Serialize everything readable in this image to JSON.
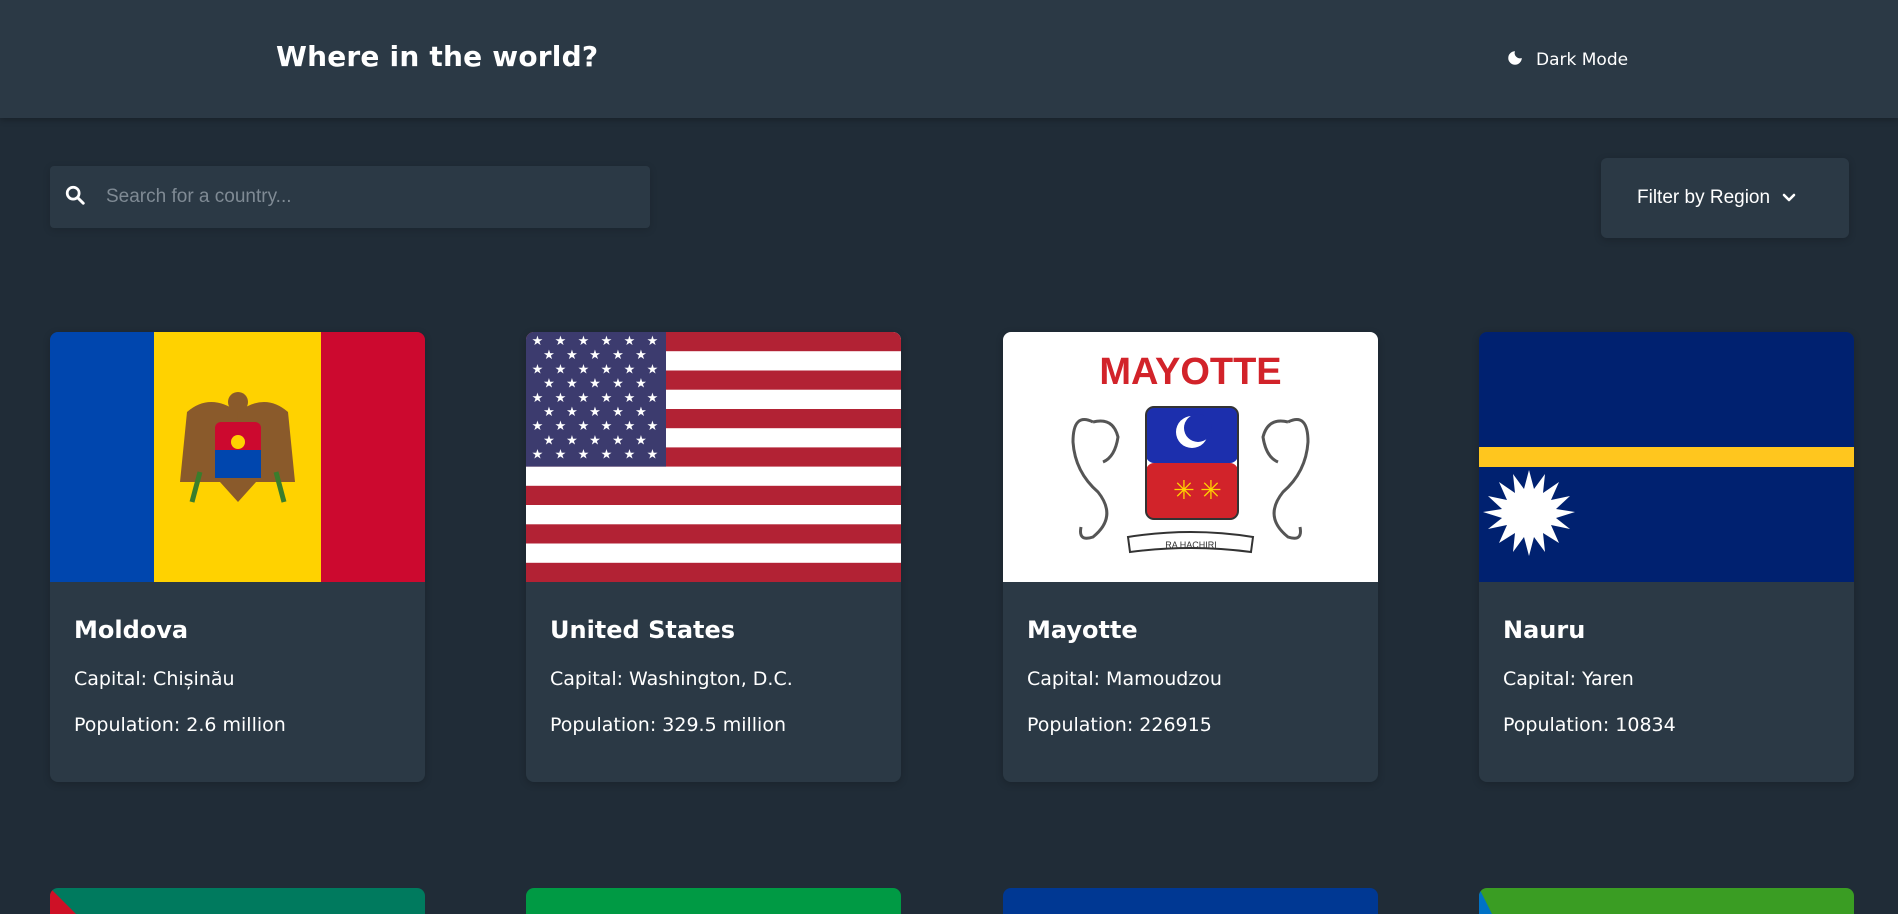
{
  "header": {
    "title": "Where in the world?",
    "mode_label": "Dark Mode",
    "mode_icon": "moon-icon"
  },
  "search": {
    "placeholder": "Search for a country...",
    "value": "",
    "icon": "search-icon"
  },
  "filter": {
    "label": "Filter by Region",
    "icon": "chevron-down-icon"
  },
  "countries": [
    {
      "name": "Moldova",
      "capital": "Capital: Chișinău",
      "population": "Population: 2.6 million"
    },
    {
      "name": "United States",
      "capital": "Capital: Washington, D.C.",
      "population": "Population: 329.5 million"
    },
    {
      "name": "Mayotte",
      "capital": "Capital: Mamoudzou",
      "population": "Population: 226915",
      "flag_text": "MAYOTTE",
      "motto": "RA HACHIRI"
    },
    {
      "name": "Nauru",
      "capital": "Capital: Yaren",
      "population": "Population: 10834"
    }
  ],
  "colors": {
    "background": "#202c37",
    "element": "#2b3945",
    "text": "#ffffff"
  }
}
